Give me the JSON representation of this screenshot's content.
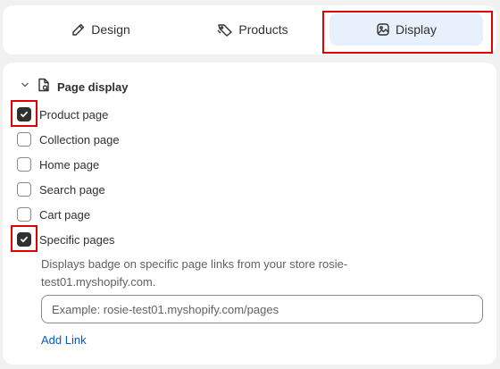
{
  "tabs": [
    {
      "label": "Design",
      "icon": "pencil-icon"
    },
    {
      "label": "Products",
      "icon": "tag-icon"
    },
    {
      "label": "Display",
      "icon": "image-icon",
      "selected": true
    }
  ],
  "section": {
    "title": "Page display",
    "options": [
      {
        "label": "Product page",
        "checked": true
      },
      {
        "label": "Collection page",
        "checked": false
      },
      {
        "label": "Home page",
        "checked": false
      },
      {
        "label": "Search page",
        "checked": false
      },
      {
        "label": "Cart page",
        "checked": false
      },
      {
        "label": "Specific pages",
        "checked": true
      }
    ],
    "help_text": "Displays badge on specific page links from your store rosie-test01.myshopify.com.",
    "input_placeholder": "Example: rosie-test01.myshopify.com/pages",
    "input_value": "",
    "add_link_label": "Add Link"
  },
  "colors": {
    "accent_link": "#005bd3",
    "selected_tab_bg": "#e8f0fb",
    "highlight": "#e00000"
  }
}
